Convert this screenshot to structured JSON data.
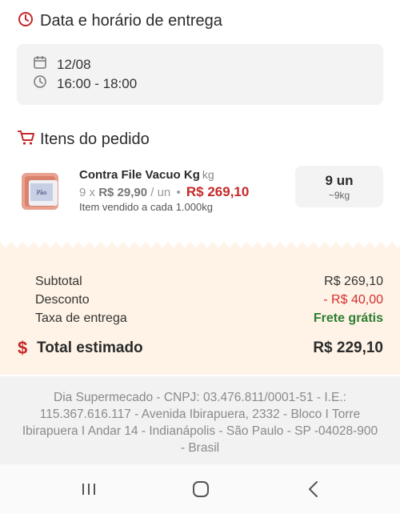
{
  "delivery": {
    "title": "Data e horário de entrega",
    "date": "12/08",
    "time": "16:00 - 18:00"
  },
  "items": {
    "title": "Itens do pedido",
    "list": [
      {
        "name": "Contra File Vacuo Kg",
        "unit": "kg",
        "quantity_prefix": "9 x",
        "unit_price": "R$ 29,90",
        "unit_suffix": "/ un",
        "separator": "•",
        "line_total": "R$ 269,10",
        "note": "Item vendido a cada 1.000kg",
        "qty_label": "9 un",
        "qty_weight": "~9kg"
      }
    ]
  },
  "summary": {
    "subtotal_label": "Subtotal",
    "subtotal_value": "R$ 269,10",
    "discount_label": "Desconto",
    "discount_value": "- R$ 40,00",
    "delivery_fee_label": "Taxa de entrega",
    "delivery_fee_value": "Frete grátis",
    "total_icon": "$",
    "total_label": "Total estimado",
    "total_value": "R$ 229,10"
  },
  "footer": {
    "company_info": "Dia Supermecado - CNPJ: 03.476.811/0001-51 - I.E.: 115.367.616.117 - Avenida Ibirapuera, 2332 - Bloco I Torre Ibirapuera I Andar 14 - Indianápolis - São Paulo - SP -04028-900 - Brasil"
  },
  "icons": {
    "clock": "clock-icon",
    "calendar": "calendar-icon",
    "cart": "cart-icon",
    "recents": "recent-apps-icon",
    "home": "home-icon",
    "back": "back-icon"
  },
  "colors": {
    "accent_red": "#c62828",
    "discount_red": "#d32f2f",
    "free_green": "#2e7d32",
    "summary_bg": "#fef3e6",
    "footer_bg": "#f2f2f2",
    "card_bg": "#f3f3f3"
  }
}
